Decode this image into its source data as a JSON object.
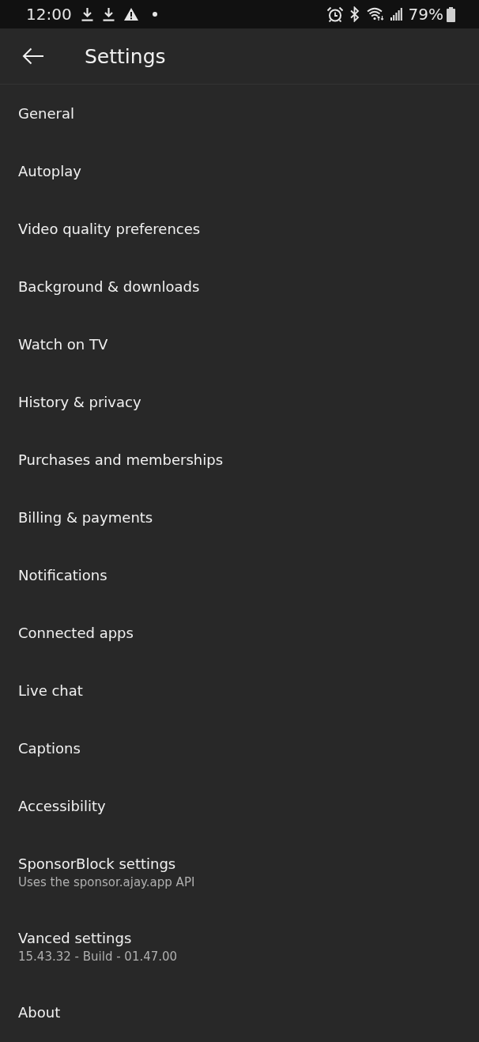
{
  "status_bar": {
    "time": "12:00",
    "battery": "79%"
  },
  "header": {
    "title": "Settings"
  },
  "items": [
    {
      "title": "General"
    },
    {
      "title": "Autoplay"
    },
    {
      "title": "Video quality preferences"
    },
    {
      "title": "Background & downloads"
    },
    {
      "title": "Watch on TV"
    },
    {
      "title": "History & privacy"
    },
    {
      "title": "Purchases and memberships"
    },
    {
      "title": "Billing & payments"
    },
    {
      "title": "Notifications"
    },
    {
      "title": "Connected apps"
    },
    {
      "title": "Live chat"
    },
    {
      "title": "Captions"
    },
    {
      "title": "Accessibility"
    },
    {
      "title": "SponsorBlock settings",
      "subtitle": "Uses the sponsor.ajay.app API"
    },
    {
      "title": "Vanced settings",
      "subtitle": "15.43.32 - Build - 01.47.00"
    },
    {
      "title": "About"
    }
  ]
}
